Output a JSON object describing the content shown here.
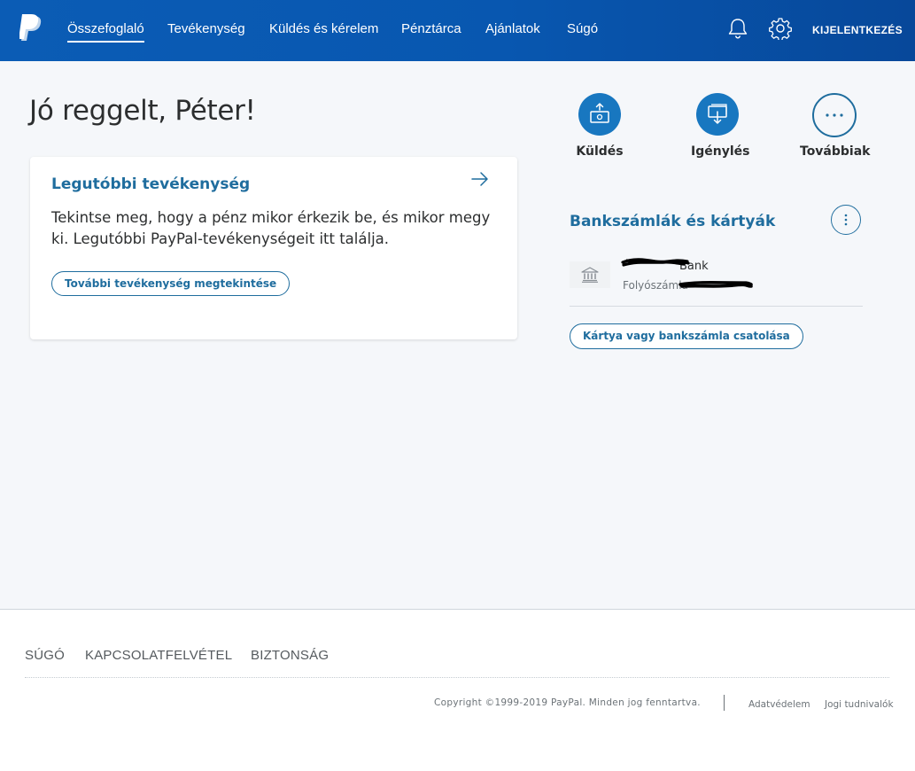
{
  "header": {
    "nav": [
      {
        "label": "Összefoglaló",
        "active": true
      },
      {
        "label": "Tevékenység"
      },
      {
        "label": "Küldés és kérelem"
      },
      {
        "label": "Pénztárca"
      },
      {
        "label": "Ajánlatok"
      },
      {
        "label": "Súgó"
      }
    ],
    "icons": {
      "notifications": "bell-icon",
      "settings": "gear-icon"
    },
    "logout_label": "KIJELENTKEZÉS"
  },
  "main": {
    "greeting": "Jó reggelt, Péter!",
    "activity_card": {
      "title": "Legutóbbi tevékenység",
      "text": "Tekintse meg, hogy a pénz mikor érkezik be, és mikor megy ki. Legutóbbi PayPal-tevékenységeit itt találja.",
      "button_label": "További tevékenység megtekintése"
    },
    "quick_actions": [
      {
        "label": "Küldés",
        "icon": "send-money-icon"
      },
      {
        "label": "Igénylés",
        "icon": "request-money-icon"
      },
      {
        "label": "Továbbiak",
        "icon": "more-dots-icon"
      }
    ],
    "accounts": {
      "title": "Bankszámlák és kártyák",
      "bank": {
        "name": "Bank",
        "type": "Folyószámla",
        "icon": "bank-icon"
      },
      "link_button_label": "Kártya vagy bankszámla csatolása"
    }
  },
  "footer": {
    "links": [
      "SÚGÓ",
      "KAPCSOLATFELVÉTEL",
      "BIZTONSÁG"
    ],
    "copyright": "Copyright ©1999-2019 PayPal. Minden jog fenntartva.",
    "legal_links": [
      "Adatvédelem",
      "Jogi tudnivalók"
    ]
  },
  "colors": {
    "header_bg": "#0b5cb5",
    "accent": "#1f6d9e",
    "action_fill": "#1877c0",
    "page_bg": "#f5f7fa"
  }
}
